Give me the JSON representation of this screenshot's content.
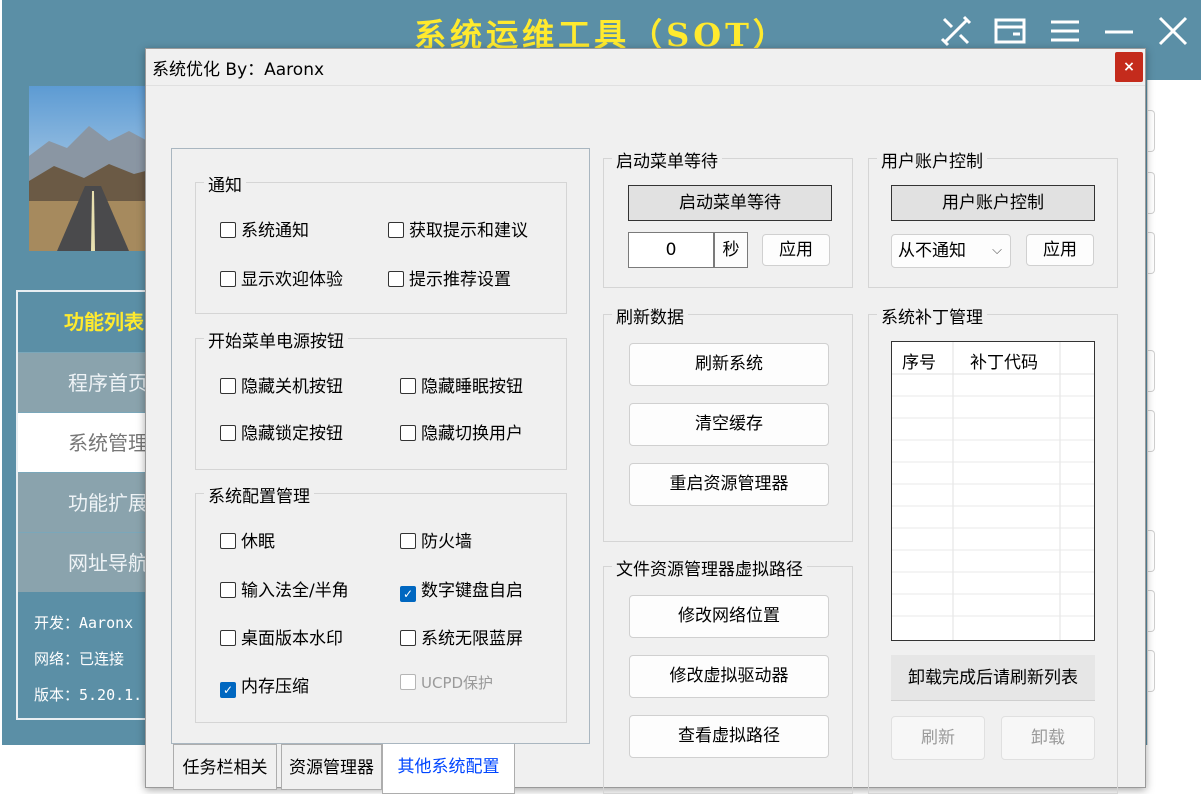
{
  "app": {
    "title": "系统运维工具（SOT）",
    "titlebar_icons": [
      "tools-icon",
      "window-icon",
      "menu-icon",
      "minimize-icon",
      "close-icon"
    ],
    "menu": {
      "title": "功能列表",
      "items": [
        "程序首页",
        "系统管理",
        "功能扩展",
        "网址导航"
      ],
      "active_index": 1
    },
    "info": [
      "开发：Aaronx",
      "网络：已连接",
      "版本：5.20.1."
    ]
  },
  "dialog": {
    "title": "系统优化  By：Aaronx",
    "close_label": "×",
    "tabs": [
      {
        "label": "任务栏相关",
        "active": false
      },
      {
        "label": "资源管理器",
        "active": false
      },
      {
        "label": "其他系统配置",
        "active": true
      }
    ],
    "groups": {
      "notify": {
        "title": "通知",
        "items": [
          {
            "label": "系统通知",
            "checked": false
          },
          {
            "label": "获取提示和建议",
            "checked": false
          },
          {
            "label": "显示欢迎体验",
            "checked": false
          },
          {
            "label": "提示推荐设置",
            "checked": false
          }
        ]
      },
      "power": {
        "title": "开始菜单电源按钮",
        "items": [
          {
            "label": "隐藏关机按钮",
            "checked": false
          },
          {
            "label": "隐藏睡眠按钮",
            "checked": false
          },
          {
            "label": "隐藏锁定按钮",
            "checked": false
          },
          {
            "label": "隐藏切换用户",
            "checked": false
          }
        ]
      },
      "config": {
        "title": "系统配置管理",
        "items": [
          {
            "label": "休眠",
            "checked": false
          },
          {
            "label": "防火墙",
            "checked": false
          },
          {
            "label": "输入法全/半角",
            "checked": false
          },
          {
            "label": "数字键盘自启",
            "checked": true
          },
          {
            "label": "桌面版本水印",
            "checked": false
          },
          {
            "label": "系统无限蓝屏",
            "checked": false
          },
          {
            "label": "内存压缩",
            "checked": true
          },
          {
            "label": "UCPD保护",
            "checked": false,
            "disabled": true
          }
        ]
      }
    },
    "start_wait": {
      "title": "启动菜单等待",
      "button": "启动菜单等待",
      "value": "0",
      "unit": "秒",
      "apply": "应用"
    },
    "uac": {
      "title": "用户账户控制",
      "button": "用户账户控制",
      "select_value": "从不通知",
      "apply": "应用"
    },
    "refresh": {
      "title": "刷新数据",
      "buttons": [
        "刷新系统",
        "清空缓存",
        "重启资源管理器"
      ]
    },
    "virtual_path": {
      "title": "文件资源管理器虚拟路径",
      "buttons": [
        "修改网络位置",
        "修改虚拟驱动器",
        "查看虚拟路径"
      ]
    },
    "patch": {
      "title": "系统补丁管理",
      "columns": [
        "序号",
        "补丁代码"
      ],
      "hint": "卸载完成后请刷新列表",
      "refresh": "刷新",
      "uninstall": "卸载"
    }
  }
}
